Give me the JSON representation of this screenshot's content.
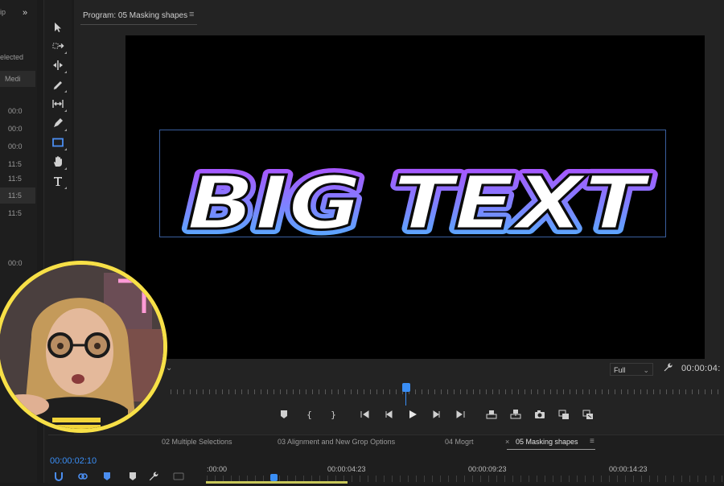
{
  "project_panel": {
    "header_partial": "ip",
    "collapse_glyph": "»",
    "selected_partial": "elected",
    "media_partial": "Medi",
    "rows": [
      "00:0",
      "00:0",
      "00:0",
      "11:5",
      "11:5",
      "11:5",
      "11:5",
      "00:0"
    ]
  },
  "tools": {
    "items": [
      {
        "name": "selection-tool-icon"
      },
      {
        "name": "track-select-tool-icon"
      },
      {
        "name": "ripple-edit-tool-icon"
      },
      {
        "name": "razor-tool-icon"
      },
      {
        "name": "slip-tool-icon"
      },
      {
        "name": "pen-tool-icon"
      },
      {
        "name": "rectangle-tool-icon",
        "active": true
      },
      {
        "name": "hand-tool-icon"
      },
      {
        "name": "type-tool-icon"
      }
    ]
  },
  "program": {
    "title": "Program: 05 Masking shapes",
    "menu_glyph": "≡",
    "overlay_text": "BIG TEXT",
    "gradient": [
      "#b14cff",
      "#4fb3ff"
    ],
    "fit_label": "Full",
    "fit_chevron": "⌄",
    "left_dropdown_chevron": "⌄",
    "timecode": "00:00:04:",
    "wrench_glyph": "🔧"
  },
  "transport": {
    "buttons": [
      "add-marker-button",
      "mark-in-button",
      "mark-out-button",
      "go-to-in-button",
      "step-back-button",
      "play-button",
      "step-forward-button",
      "go-to-out-button",
      "lift-button",
      "extract-button",
      "export-frame-button",
      "insert-button",
      "overwrite-button"
    ]
  },
  "timeline": {
    "tabs": [
      {
        "label": "02 Multiple Selections"
      },
      {
        "label": "03 Alignment and New Grop Options"
      },
      {
        "label": "04 Mogrt"
      },
      {
        "label": "05 Masking shapes",
        "active": true
      }
    ],
    "close_glyph": "×",
    "menu_glyph": "≡",
    "current_timecode": "00:00:02:10",
    "ruler_labels": [
      ":00:00",
      "00:00:04:23",
      "00:00:09:23",
      "00:00:14:23"
    ]
  },
  "colors": {
    "accent": "#3a8ef5",
    "webcam_border": "#f7e047",
    "selection_box": "#3a5f9e"
  }
}
